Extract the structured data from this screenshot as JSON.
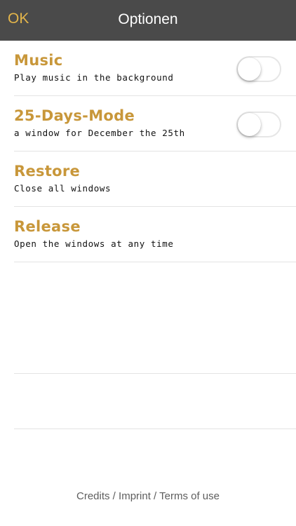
{
  "navbar": {
    "ok_label": "OK",
    "title": "Optionen"
  },
  "options": [
    {
      "title": "Music",
      "description": "Play music in the background",
      "has_toggle": true,
      "toggle_on": false
    },
    {
      "title": "25-Days-Mode",
      "description": "a window for December the 25th",
      "has_toggle": true,
      "toggle_on": false
    },
    {
      "title": "Restore",
      "description": "Close all windows",
      "has_toggle": false
    },
    {
      "title": "Release",
      "description": "Open the windows at any time",
      "has_toggle": false
    }
  ],
  "footer": {
    "credits": "Credits",
    "separator": " / ",
    "imprint": "Imprint",
    "terms": "Terms of use"
  },
  "colors": {
    "navbar_bg": "#4a4a4a",
    "accent": "#e3b54a",
    "option_title": "#c8973a"
  }
}
